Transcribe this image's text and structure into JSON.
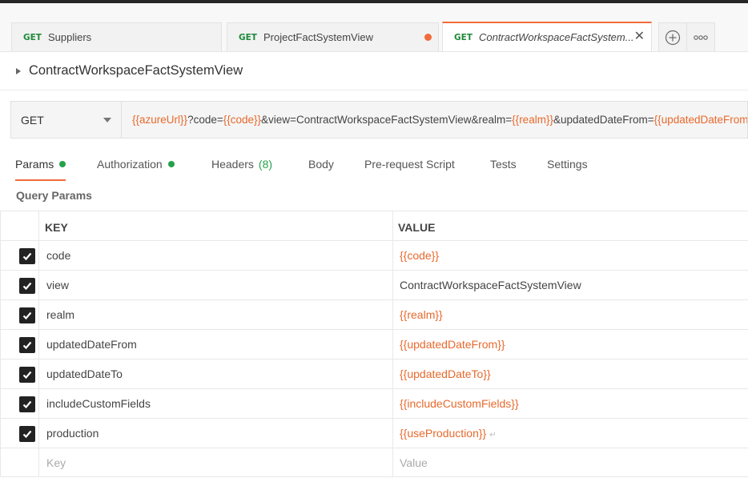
{
  "tabs": [
    {
      "method": "GET",
      "label": "Suppliers"
    },
    {
      "method": "GET",
      "label": "ProjectFactSystemView"
    },
    {
      "method": "GET",
      "label": "ContractWorkspaceFactSystem..."
    }
  ],
  "request_title": "ContractWorkspaceFactSystemView",
  "url": {
    "method": "GET",
    "parts": [
      {
        "text": "{{azureUrl}}",
        "var": true
      },
      {
        "text": "?code=",
        "var": false
      },
      {
        "text": "{{code}}",
        "var": true
      },
      {
        "text": "&view=ContractWorkspaceFactSystemView&realm=",
        "var": false
      },
      {
        "text": "{{realm}}",
        "var": true
      },
      {
        "text": "&updatedDateFrom=",
        "var": false
      },
      {
        "text": "{{updatedDateFrom}}",
        "var": true
      }
    ]
  },
  "request_tabs": {
    "params": "Params",
    "authorization": "Authorization",
    "headers": "Headers",
    "headers_count": "(8)",
    "body": "Body",
    "prerequest": "Pre-request Script",
    "tests": "Tests",
    "settings": "Settings"
  },
  "section_title": "Query Params",
  "table": {
    "key_header": "KEY",
    "value_header": "VALUE",
    "rows": [
      {
        "key": "code",
        "value": "{{code}}",
        "is_var": true
      },
      {
        "key": "view",
        "value": "ContractWorkspaceFactSystemView",
        "is_var": false
      },
      {
        "key": "realm",
        "value": "{{realm}}",
        "is_var": true
      },
      {
        "key": "updatedDateFrom",
        "value": "{{updatedDateFrom}}",
        "is_var": true
      },
      {
        "key": "updatedDateTo",
        "value": "{{updatedDateTo}}",
        "is_var": true
      },
      {
        "key": "includeCustomFields",
        "value": "{{includeCustomFields}}",
        "is_var": true
      },
      {
        "key": "production",
        "value": "{{useProduction}}",
        "is_var": true
      }
    ],
    "new_key_placeholder": "Key",
    "new_value_placeholder": "Value"
  },
  "colors": {
    "accent": "#f26b3a",
    "variable": "#e8692c",
    "method_green": "#1f8a3a",
    "status_green": "#26a14b"
  }
}
